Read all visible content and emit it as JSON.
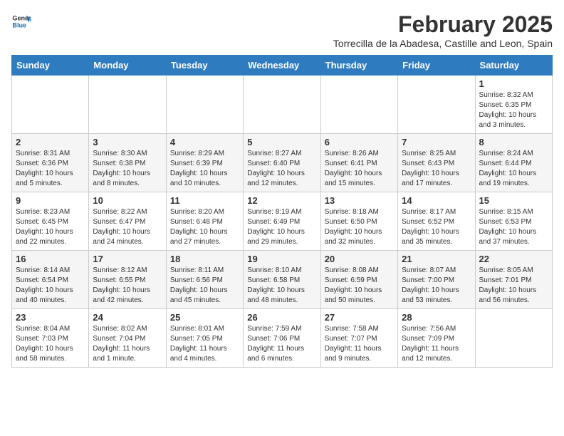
{
  "logo": {
    "general": "General",
    "blue": "Blue"
  },
  "header": {
    "month": "February 2025",
    "location": "Torrecilla de la Abadesa, Castille and Leon, Spain"
  },
  "weekdays": [
    "Sunday",
    "Monday",
    "Tuesday",
    "Wednesday",
    "Thursday",
    "Friday",
    "Saturday"
  ],
  "weeks": [
    [
      {
        "day": "",
        "info": ""
      },
      {
        "day": "",
        "info": ""
      },
      {
        "day": "",
        "info": ""
      },
      {
        "day": "",
        "info": ""
      },
      {
        "day": "",
        "info": ""
      },
      {
        "day": "",
        "info": ""
      },
      {
        "day": "1",
        "info": "Sunrise: 8:32 AM\nSunset: 6:35 PM\nDaylight: 10 hours\nand 3 minutes."
      }
    ],
    [
      {
        "day": "2",
        "info": "Sunrise: 8:31 AM\nSunset: 6:36 PM\nDaylight: 10 hours\nand 5 minutes."
      },
      {
        "day": "3",
        "info": "Sunrise: 8:30 AM\nSunset: 6:38 PM\nDaylight: 10 hours\nand 8 minutes."
      },
      {
        "day": "4",
        "info": "Sunrise: 8:29 AM\nSunset: 6:39 PM\nDaylight: 10 hours\nand 10 minutes."
      },
      {
        "day": "5",
        "info": "Sunrise: 8:27 AM\nSunset: 6:40 PM\nDaylight: 10 hours\nand 12 minutes."
      },
      {
        "day": "6",
        "info": "Sunrise: 8:26 AM\nSunset: 6:41 PM\nDaylight: 10 hours\nand 15 minutes."
      },
      {
        "day": "7",
        "info": "Sunrise: 8:25 AM\nSunset: 6:43 PM\nDaylight: 10 hours\nand 17 minutes."
      },
      {
        "day": "8",
        "info": "Sunrise: 8:24 AM\nSunset: 6:44 PM\nDaylight: 10 hours\nand 19 minutes."
      }
    ],
    [
      {
        "day": "9",
        "info": "Sunrise: 8:23 AM\nSunset: 6:45 PM\nDaylight: 10 hours\nand 22 minutes."
      },
      {
        "day": "10",
        "info": "Sunrise: 8:22 AM\nSunset: 6:47 PM\nDaylight: 10 hours\nand 24 minutes."
      },
      {
        "day": "11",
        "info": "Sunrise: 8:20 AM\nSunset: 6:48 PM\nDaylight: 10 hours\nand 27 minutes."
      },
      {
        "day": "12",
        "info": "Sunrise: 8:19 AM\nSunset: 6:49 PM\nDaylight: 10 hours\nand 29 minutes."
      },
      {
        "day": "13",
        "info": "Sunrise: 8:18 AM\nSunset: 6:50 PM\nDaylight: 10 hours\nand 32 minutes."
      },
      {
        "day": "14",
        "info": "Sunrise: 8:17 AM\nSunset: 6:52 PM\nDaylight: 10 hours\nand 35 minutes."
      },
      {
        "day": "15",
        "info": "Sunrise: 8:15 AM\nSunset: 6:53 PM\nDaylight: 10 hours\nand 37 minutes."
      }
    ],
    [
      {
        "day": "16",
        "info": "Sunrise: 8:14 AM\nSunset: 6:54 PM\nDaylight: 10 hours\nand 40 minutes."
      },
      {
        "day": "17",
        "info": "Sunrise: 8:12 AM\nSunset: 6:55 PM\nDaylight: 10 hours\nand 42 minutes."
      },
      {
        "day": "18",
        "info": "Sunrise: 8:11 AM\nSunset: 6:56 PM\nDaylight: 10 hours\nand 45 minutes."
      },
      {
        "day": "19",
        "info": "Sunrise: 8:10 AM\nSunset: 6:58 PM\nDaylight: 10 hours\nand 48 minutes."
      },
      {
        "day": "20",
        "info": "Sunrise: 8:08 AM\nSunset: 6:59 PM\nDaylight: 10 hours\nand 50 minutes."
      },
      {
        "day": "21",
        "info": "Sunrise: 8:07 AM\nSunset: 7:00 PM\nDaylight: 10 hours\nand 53 minutes."
      },
      {
        "day": "22",
        "info": "Sunrise: 8:05 AM\nSunset: 7:01 PM\nDaylight: 10 hours\nand 56 minutes."
      }
    ],
    [
      {
        "day": "23",
        "info": "Sunrise: 8:04 AM\nSunset: 7:03 PM\nDaylight: 10 hours\nand 58 minutes."
      },
      {
        "day": "24",
        "info": "Sunrise: 8:02 AM\nSunset: 7:04 PM\nDaylight: 11 hours\nand 1 minute."
      },
      {
        "day": "25",
        "info": "Sunrise: 8:01 AM\nSunset: 7:05 PM\nDaylight: 11 hours\nand 4 minutes."
      },
      {
        "day": "26",
        "info": "Sunrise: 7:59 AM\nSunset: 7:06 PM\nDaylight: 11 hours\nand 6 minutes."
      },
      {
        "day": "27",
        "info": "Sunrise: 7:58 AM\nSunset: 7:07 PM\nDaylight: 11 hours\nand 9 minutes."
      },
      {
        "day": "28",
        "info": "Sunrise: 7:56 AM\nSunset: 7:09 PM\nDaylight: 11 hours\nand 12 minutes."
      },
      {
        "day": "",
        "info": ""
      }
    ]
  ]
}
